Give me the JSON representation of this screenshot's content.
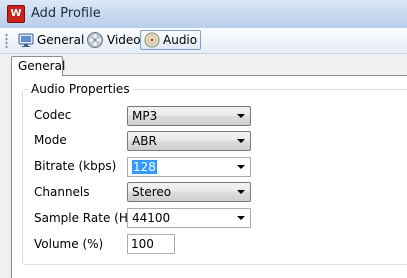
{
  "window": {
    "title": "Add Profile",
    "app_icon": "app-logo-icon",
    "close_icon": "close-icon"
  },
  "toolbar": {
    "buttons": [
      {
        "label": "General",
        "icon": "monitor-icon"
      },
      {
        "label": "Video",
        "icon": "film-reel-icon"
      },
      {
        "label": "Audio",
        "icon": "audio-disc-icon",
        "active": true
      }
    ]
  },
  "tabs": {
    "general_label": "General"
  },
  "audio_properties": {
    "group_label": "Audio Properties",
    "codec": {
      "label": "Codec",
      "value": "MP3"
    },
    "mode": {
      "label": "Mode",
      "value": "ABR"
    },
    "bitrate": {
      "label": "Bitrate (kbps)",
      "value": "128"
    },
    "channels": {
      "label": "Channels",
      "value": "Stereo"
    },
    "sample_rate": {
      "label": "Sample Rate (Hz)",
      "value": "44100"
    },
    "volume": {
      "label": "Volume (%)",
      "value": "100"
    }
  },
  "colors": {
    "selection": "#3399ff",
    "titlebar": "#c6d8ef",
    "app_icon": "#c8221b"
  }
}
